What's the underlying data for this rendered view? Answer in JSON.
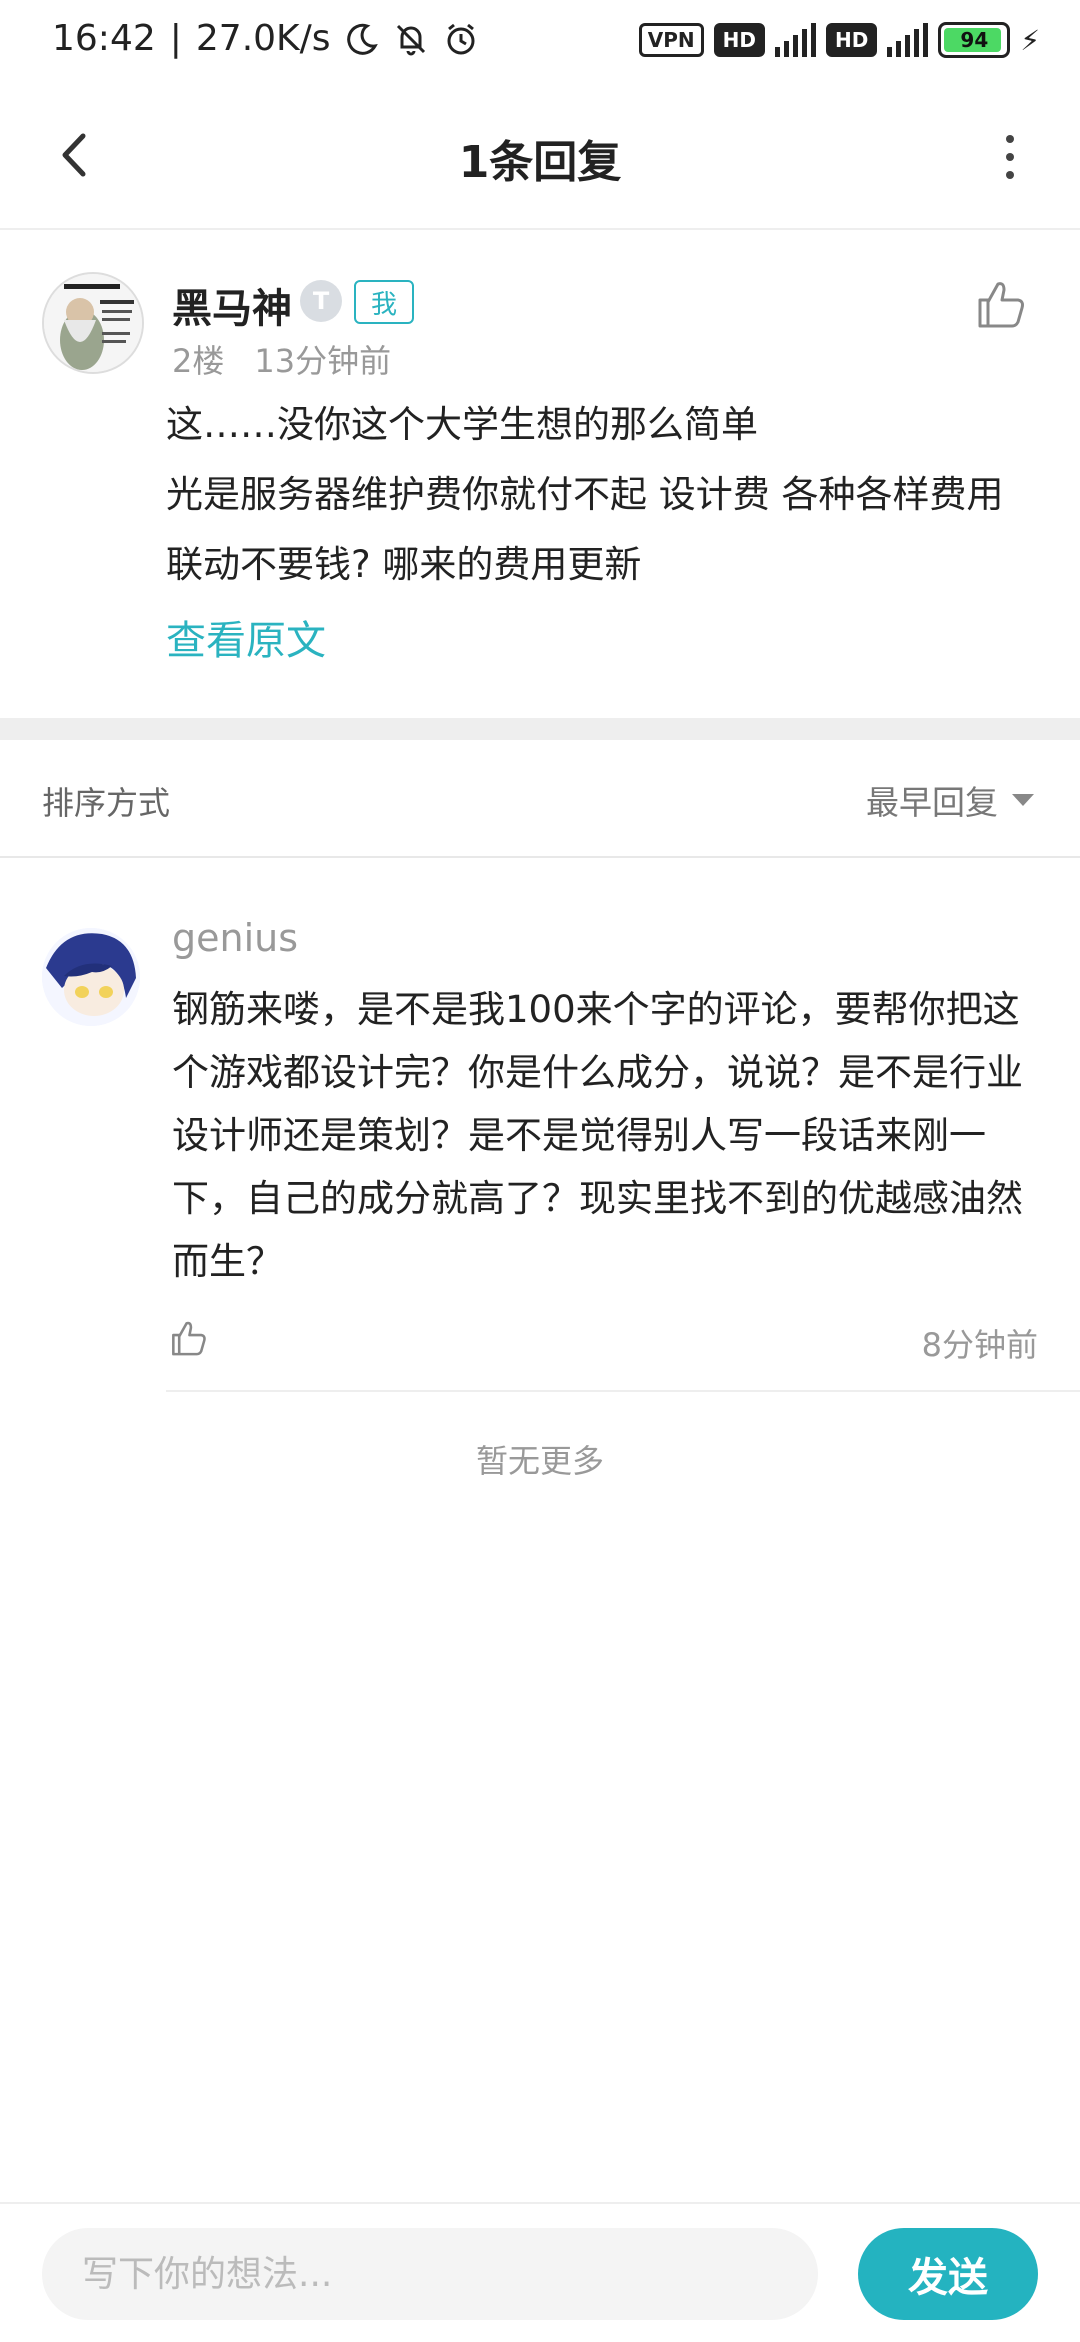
{
  "status_bar": {
    "time": "16:42",
    "speed": "27.0K/s",
    "vpn": "VPN",
    "hd": "HD",
    "network": "4G",
    "battery": "94"
  },
  "header": {
    "title": "1条回复"
  },
  "post": {
    "author": "黑马神",
    "level_badge": "T",
    "me_badge": "我",
    "floor": "2楼",
    "time": "13分钟前",
    "body_line1": "这……没你这个大学生想的那么简单",
    "body_line2": "光是服务器维护费你就付不起 设计费 各种各样费用 联动不要钱? 哪来的费用更新",
    "view_original": "查看原文",
    "avatar_text": "..的理学院.. 懂得生活"
  },
  "sort": {
    "label": "排序方式",
    "selected": "最早回复"
  },
  "reply": {
    "author": "genius",
    "body": "钢筋来喽，是不是我100来个字的评论，要帮你把这个游戏都设计完？你是什么成分，说说？是不是行业设计师还是策划？是不是觉得别人写一段话来刚一下，自己的成分就高了？现实里找不到的优越感油然而生？",
    "time": "8分钟前"
  },
  "footer": {
    "no_more": "暂无更多"
  },
  "bottom_bar": {
    "input_placeholder": "写下你的想法...",
    "send_label": "发送"
  },
  "colors": {
    "accent": "#24b3c0",
    "battery": "#4cd964"
  }
}
